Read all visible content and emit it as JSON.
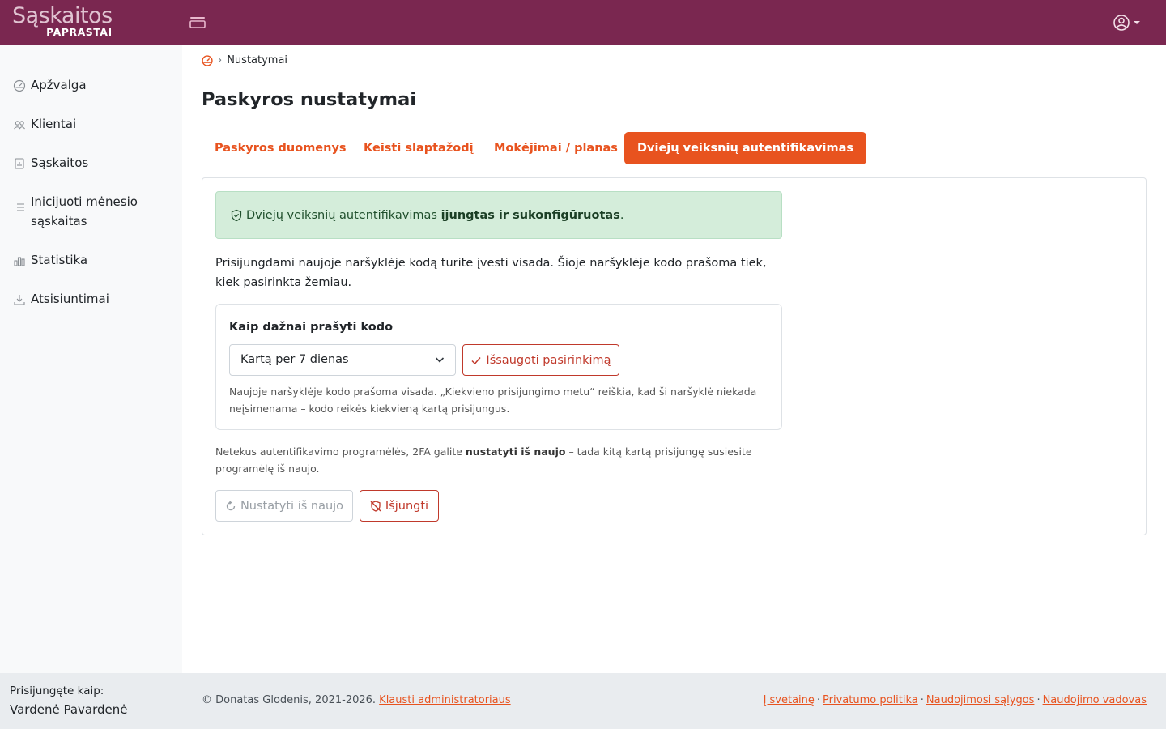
{
  "brand": {
    "main": "Sąskaitos",
    "sub": "PAPRASTAI"
  },
  "colors": {
    "topbar": "#7a2750",
    "accent": "#e8531f",
    "danger": "#c0392b",
    "success_bg": "#d4edda"
  },
  "sidebar": {
    "items": [
      {
        "label": "Apžvalga",
        "icon": "dashboard-icon"
      },
      {
        "label": "Klientai",
        "icon": "users-icon"
      },
      {
        "label": "Sąskaitos",
        "icon": "invoice-icon"
      },
      {
        "label": "Inicijuoti mėnesio sąskaitas",
        "icon": "list-icon"
      },
      {
        "label": "Statistika",
        "icon": "chart-icon"
      },
      {
        "label": "Atsisiuntimai",
        "icon": "download-icon"
      }
    ]
  },
  "breadcrumb": {
    "current": "Nustatymai"
  },
  "page": {
    "title": "Paskyros nustatymai"
  },
  "tabs": [
    {
      "label": "Paskyros duomenys",
      "active": false
    },
    {
      "label": "Keisti slaptažodį",
      "active": false
    },
    {
      "label": "Mokėjimai / planas",
      "active": false
    },
    {
      "label": "Dviejų veiksnių autentifikavimas",
      "active": true
    }
  ],
  "twofa": {
    "alert_prefix": "Dviejų veiksnių autentifikavimas ",
    "alert_bold": "įjungtas ir sukonfigūruotas",
    "alert_suffix": ".",
    "intro": "Prisijungdami naujoje naršyklėje kodą turite įvesti visada. Šioje naršyklėje kodo prašoma tiek, kiek pasirinkta žemiau.",
    "frequency_title": "Kaip dažnai prašyti kodo",
    "frequency_selected": "Kartą per 7 dienas",
    "save_label": "Išsaugoti pasirinkimą",
    "frequency_help": "Naujoje naršyklėje kodo prašoma visada. „Kiekvieno prisijungimo metu“ reiškia, kad ši naršyklė niekada neįsimenama – kodo reikės kiekvieną kartą prisijungus.",
    "recover_prefix": "Netekus autentifikavimo programėlės, 2FA galite ",
    "recover_bold": "nustatyti iš naujo",
    "recover_suffix": " – tada kitą kartą prisijungę susiesite programėlę iš naujo.",
    "reset_label": "Nustatyti iš naujo",
    "disable_label": "Išjungti"
  },
  "footer": {
    "login_label": "Prisijungęte kaip:",
    "login_name": "Vardenė Pavardenė",
    "copyright": "© Donatas Glodenis, 2021-2026. ",
    "contact_link": "Klausti administratoriaus",
    "links": [
      "Į svetainę",
      "Privatumo politika",
      "Naudojimosi sąlygos",
      "Naudojimo vadovas"
    ],
    "separator": "·"
  }
}
